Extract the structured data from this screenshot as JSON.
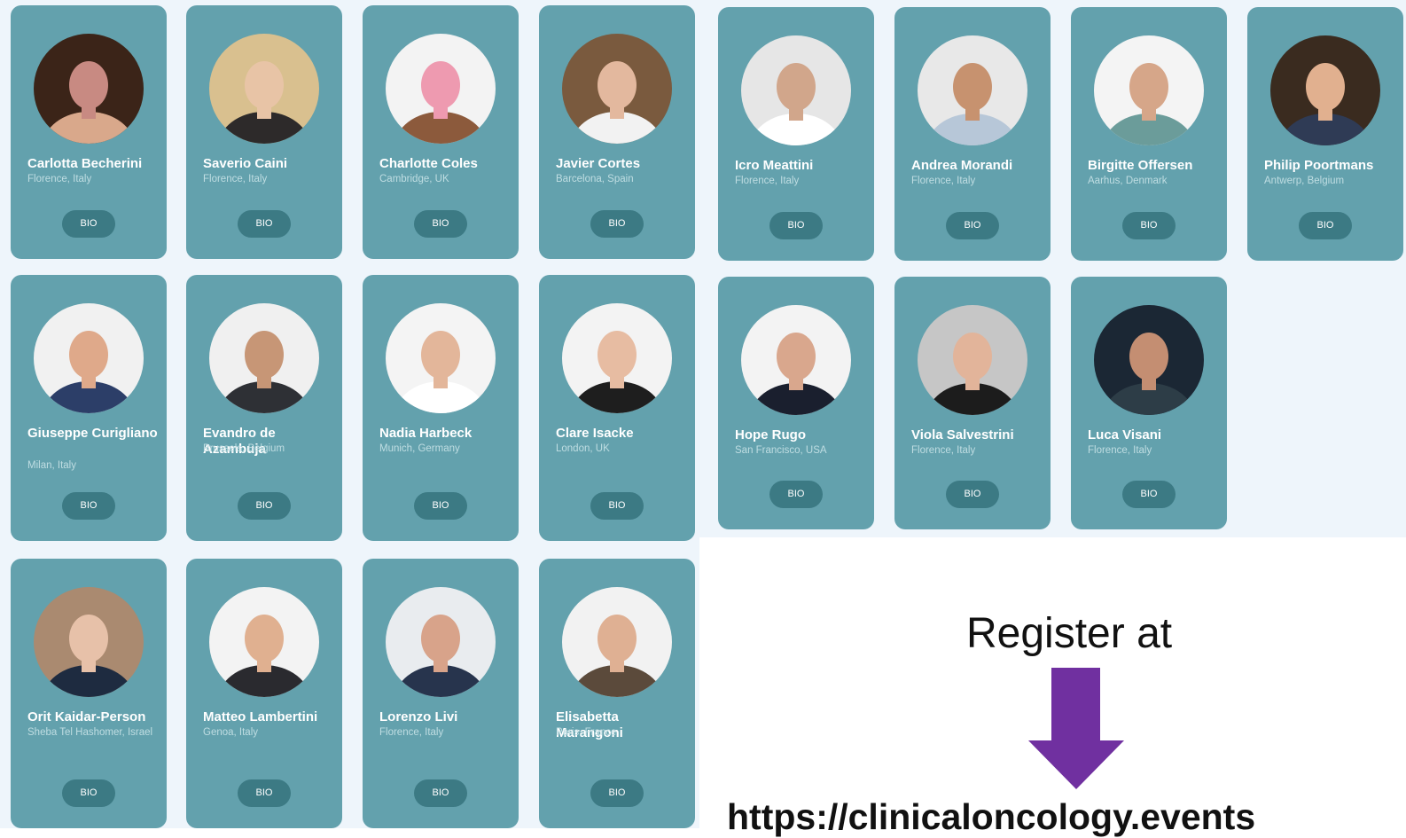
{
  "speakers": [
    {
      "name": "Carlotta Becherini",
      "location": "Florence, Italy",
      "bio": "BIO"
    },
    {
      "name": "Saverio Caini",
      "location": "Florence, Italy",
      "bio": "BIO"
    },
    {
      "name": "Charlotte Coles",
      "location": "Cambridge, UK",
      "bio": "BIO"
    },
    {
      "name": "Javier Cortes",
      "location": "Barcelona, Spain",
      "bio": "BIO"
    },
    {
      "name": "Icro Meattini",
      "location": "Florence, Italy",
      "bio": "BIO"
    },
    {
      "name": "Andrea Morandi",
      "location": "Florence, Italy",
      "bio": "BIO"
    },
    {
      "name": "Birgitte Offersen",
      "location": "Aarhus, Denmark",
      "bio": "BIO"
    },
    {
      "name": "Philip Poortmans",
      "location": "Antwerp, Belgium",
      "bio": "BIO"
    },
    {
      "name": "Giuseppe Curigliano",
      "location": "Milan, Italy",
      "bio": "BIO"
    },
    {
      "name": "Evandro de Azambuja",
      "location": "Brussels, Belgium",
      "bio": "BIO"
    },
    {
      "name": "Nadia Harbeck",
      "location": "Munich, Germany",
      "bio": "BIO"
    },
    {
      "name": "Clare Isacke",
      "location": "London, UK",
      "bio": "BIO"
    },
    {
      "name": "Hope Rugo",
      "location": "San Francisco, USA",
      "bio": "BIO"
    },
    {
      "name": "Viola Salvestrini",
      "location": "Florence, Italy",
      "bio": "BIO"
    },
    {
      "name": "Luca Visani",
      "location": "Florence, Italy",
      "bio": "BIO"
    },
    {
      "name": "Orit Kaidar-Person",
      "location": "Sheba Tel Hashomer, Israel",
      "bio": "BIO"
    },
    {
      "name": "Matteo Lambertini",
      "location": "Genoa, Italy",
      "bio": "BIO"
    },
    {
      "name": "Lorenzo Livi",
      "location": "Florence, Italy",
      "bio": "BIO"
    },
    {
      "name": "Elisabetta Marangoni",
      "location": "Paris, France",
      "bio": "BIO"
    }
  ],
  "register": {
    "text": "Register at",
    "url": "https://clinicaloncology.events"
  },
  "colors": {
    "card": "#63a1ad",
    "bio_button": "#3c7a84",
    "arrow": "#7030a0",
    "page_bg": "#eef5fb"
  }
}
